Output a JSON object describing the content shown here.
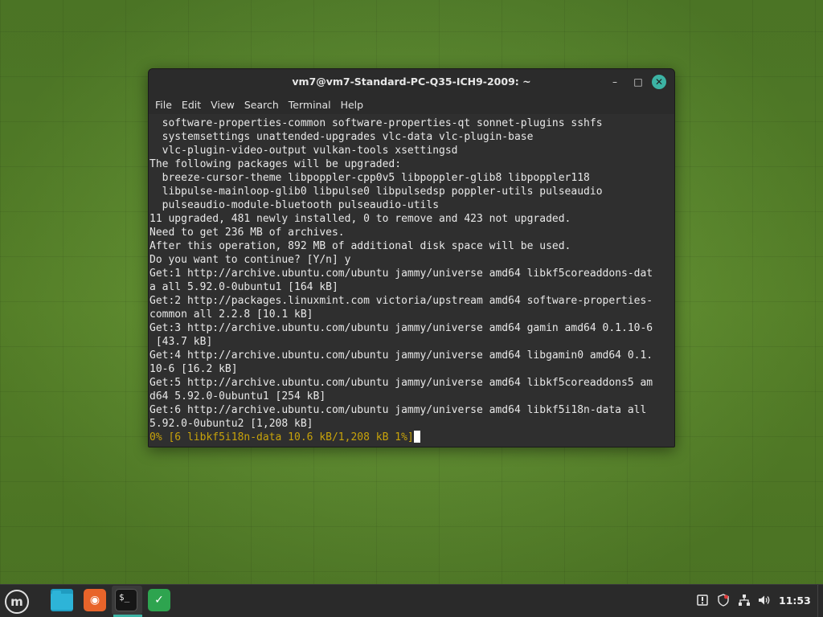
{
  "window": {
    "title": "vm7@vm7-Standard-PC-Q35-ICH9-2009: ~",
    "controls": {
      "minimize": "–",
      "maximize": "□",
      "close": "✕"
    }
  },
  "menubar": {
    "items": [
      "File",
      "Edit",
      "View",
      "Search",
      "Terminal",
      "Help"
    ]
  },
  "terminal": {
    "lines": [
      "  software-properties-common software-properties-qt sonnet-plugins sshfs",
      "  systemsettings unattended-upgrades vlc-data vlc-plugin-base",
      "  vlc-plugin-video-output vulkan-tools xsettingsd",
      "The following packages will be upgraded:",
      "  breeze-cursor-theme libpoppler-cpp0v5 libpoppler-glib8 libpoppler118",
      "  libpulse-mainloop-glib0 libpulse0 libpulsedsp poppler-utils pulseaudio",
      "  pulseaudio-module-bluetooth pulseaudio-utils",
      "11 upgraded, 481 newly installed, 0 to remove and 423 not upgraded.",
      "Need to get 236 MB of archives.",
      "After this operation, 892 MB of additional disk space will be used.",
      "Do you want to continue? [Y/n] y",
      "Get:1 http://archive.ubuntu.com/ubuntu jammy/universe amd64 libkf5coreaddons-dat",
      "a all 5.92.0-0ubuntu1 [164 kB]",
      "Get:2 http://packages.linuxmint.com victoria/upstream amd64 software-properties-",
      "common all 2.2.8 [10.1 kB]",
      "Get:3 http://archive.ubuntu.com/ubuntu jammy/universe amd64 gamin amd64 0.1.10-6",
      " [43.7 kB]",
      "Get:4 http://archive.ubuntu.com/ubuntu jammy/universe amd64 libgamin0 amd64 0.1.",
      "10-6 [16.2 kB]",
      "Get:5 http://archive.ubuntu.com/ubuntu jammy/universe amd64 libkf5coreaddons5 am",
      "d64 5.92.0-0ubuntu1 [254 kB]",
      "Get:6 http://archive.ubuntu.com/ubuntu jammy/universe amd64 libkf5i18n-data all",
      "5.92.0-0ubuntu2 [1,208 kB]"
    ],
    "progress_line": "0% [6 libkf5i18n-data 10.6 kB/1,208 kB 1%]",
    "progress_color": "#c8a30a"
  },
  "panel": {
    "menu_icon": "linux-mint-menu-icon",
    "launchers": [
      {
        "name": "files-icon"
      },
      {
        "name": "firefox-icon",
        "glyph": "◉"
      },
      {
        "name": "terminal-icon",
        "glyph": "$_"
      },
      {
        "name": "shield-icon",
        "glyph": "✓"
      }
    ],
    "tray": {
      "icons": [
        "update-manager-icon",
        "security-shield-icon",
        "network-icon",
        "volume-icon"
      ],
      "clock": "11:53"
    },
    "accent": "#3cb3a4"
  }
}
